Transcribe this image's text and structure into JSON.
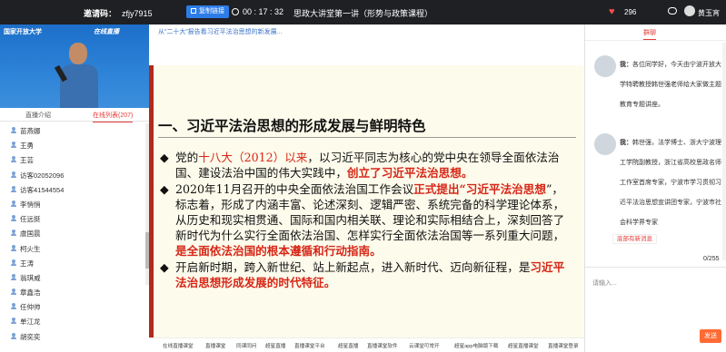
{
  "topbar": {
    "invite_label": "邀请码：",
    "invite_code": "zfjy7915",
    "copy_link": "复制链接",
    "timer": "00 : 17 : 32",
    "title": "思政大讲堂第一讲（形势与政策课程）",
    "likes": "296",
    "username": "黄玉宵"
  },
  "video": {
    "logo_left": "国家开放大学",
    "logo_right": "在线直播"
  },
  "left_tabs": [
    {
      "label": "直播介绍"
    },
    {
      "label": "在线列表(207)"
    }
  ],
  "users": [
    "苗燕娜",
    "王勇",
    "王芸",
    "访客02052096",
    "访客41544554",
    "李悄悄",
    "任远挺",
    "虞国晨",
    "柯火生",
    "王涛",
    "翁琪威",
    "章鑫浩",
    "任仲帅",
    "单江龙",
    "胡奕奕"
  ],
  "breadcrumb": "从“二十大”报告看习近平法治思想的新发展...",
  "slide": {
    "heading": "一、习近平法治思想的形成发展与鲜明特色",
    "b1": {
      "p1": "党的",
      "r1": "十八大（2012）以来",
      "p2": "，以习近平同志为核心的党中央在领导全面依法治国、建设法治中国的伟大实践中，",
      "r2": "创立了习近平法治思想。"
    },
    "b2": {
      "p1": "2020年11月召开的中央全面依法治国工作会议",
      "r1": "正式提出“习近平法治思想",
      "p2": "”，标志着，形成了内涵丰富、论述深刻、逻辑严密、系统完备的科学理论体系，从历史和现实相贯通、国际和国内相关联、理论和实际相结合上，深刻回答了新时代为什么实行全面依法治国、怎样实行全面依法治国等一系列重大问题，",
      "r2": "是全面依法治国的根本遵循和行动指南。"
    },
    "b3": {
      "p1": "开启新时期，跨入新世纪、站上新起点，进入新时代、迈向新征程，是",
      "r1": "习近平法治思想形成发展的时代特征。"
    }
  },
  "bottom_tabs": [
    "在线直播课堂",
    "直播课堂",
    "同课同问",
    "超星直播",
    "直播课堂平台",
    "超星直播",
    "直播课堂软件",
    "云课堂可常开",
    "超星app电脑版下载",
    "超星直播课堂",
    "直播课堂登录"
  ],
  "right": {
    "tab": "群聊",
    "messages": [
      {
        "name": "我：",
        "text": "各位同学好，今天由宁波开放大学特聘教授韩世强老师给大家做主题教育专题讲座。"
      },
      {
        "name": "我：",
        "text": "韩世强，法学博士、浙大宁波理工学院副教授，浙江省高校思政名师工作室首席专家，宁波市学习贯彻习近平法治思想宣讲团专家，宁波市社会科学界专家"
      }
    ],
    "new_msg": "底部有新消息",
    "counter": "0/255",
    "input_placeholder": "请输入...",
    "send": "发送"
  }
}
